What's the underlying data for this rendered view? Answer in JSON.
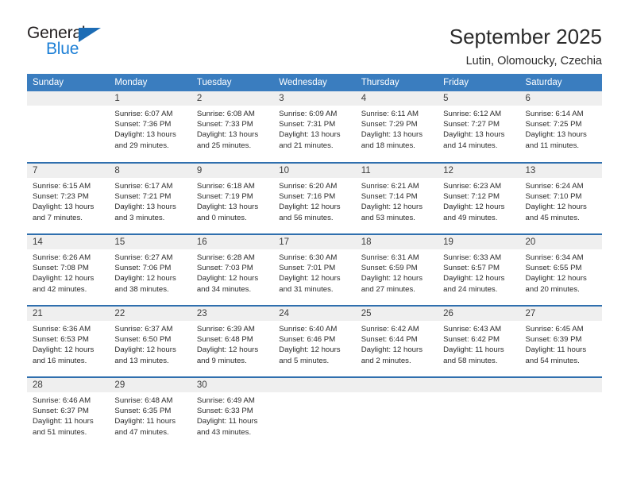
{
  "brand": {
    "name_top": "General",
    "name_bottom": "Blue",
    "accent_color": "#1c7fd6",
    "triangle_color": "#1c6cb5"
  },
  "header": {
    "title": "September 2025",
    "subtitle": "Lutin, Olomoucky, Czechia"
  },
  "calendar": {
    "header_color": "#3a7dbf",
    "daynum_background": "#efefef",
    "row_divider_color": "#2f6fae",
    "weekday_headers": [
      "Sunday",
      "Monday",
      "Tuesday",
      "Wednesday",
      "Thursday",
      "Friday",
      "Saturday"
    ],
    "labels": {
      "sunrise": "Sunrise:",
      "sunset": "Sunset:",
      "daylight": "Daylight:"
    },
    "weeks": [
      [
        {
          "day": "",
          "sunrise": "",
          "sunset": "",
          "daylight_line1": "",
          "daylight_line2": ""
        },
        {
          "day": "1",
          "sunrise": "Sunrise: 6:07 AM",
          "sunset": "Sunset: 7:36 PM",
          "daylight_line1": "Daylight: 13 hours",
          "daylight_line2": "and 29 minutes."
        },
        {
          "day": "2",
          "sunrise": "Sunrise: 6:08 AM",
          "sunset": "Sunset: 7:33 PM",
          "daylight_line1": "Daylight: 13 hours",
          "daylight_line2": "and 25 minutes."
        },
        {
          "day": "3",
          "sunrise": "Sunrise: 6:09 AM",
          "sunset": "Sunset: 7:31 PM",
          "daylight_line1": "Daylight: 13 hours",
          "daylight_line2": "and 21 minutes."
        },
        {
          "day": "4",
          "sunrise": "Sunrise: 6:11 AM",
          "sunset": "Sunset: 7:29 PM",
          "daylight_line1": "Daylight: 13 hours",
          "daylight_line2": "and 18 minutes."
        },
        {
          "day": "5",
          "sunrise": "Sunrise: 6:12 AM",
          "sunset": "Sunset: 7:27 PM",
          "daylight_line1": "Daylight: 13 hours",
          "daylight_line2": "and 14 minutes."
        },
        {
          "day": "6",
          "sunrise": "Sunrise: 6:14 AM",
          "sunset": "Sunset: 7:25 PM",
          "daylight_line1": "Daylight: 13 hours",
          "daylight_line2": "and 11 minutes."
        }
      ],
      [
        {
          "day": "7",
          "sunrise": "Sunrise: 6:15 AM",
          "sunset": "Sunset: 7:23 PM",
          "daylight_line1": "Daylight: 13 hours",
          "daylight_line2": "and 7 minutes."
        },
        {
          "day": "8",
          "sunrise": "Sunrise: 6:17 AM",
          "sunset": "Sunset: 7:21 PM",
          "daylight_line1": "Daylight: 13 hours",
          "daylight_line2": "and 3 minutes."
        },
        {
          "day": "9",
          "sunrise": "Sunrise: 6:18 AM",
          "sunset": "Sunset: 7:19 PM",
          "daylight_line1": "Daylight: 13 hours",
          "daylight_line2": "and 0 minutes."
        },
        {
          "day": "10",
          "sunrise": "Sunrise: 6:20 AM",
          "sunset": "Sunset: 7:16 PM",
          "daylight_line1": "Daylight: 12 hours",
          "daylight_line2": "and 56 minutes."
        },
        {
          "day": "11",
          "sunrise": "Sunrise: 6:21 AM",
          "sunset": "Sunset: 7:14 PM",
          "daylight_line1": "Daylight: 12 hours",
          "daylight_line2": "and 53 minutes."
        },
        {
          "day": "12",
          "sunrise": "Sunrise: 6:23 AM",
          "sunset": "Sunset: 7:12 PM",
          "daylight_line1": "Daylight: 12 hours",
          "daylight_line2": "and 49 minutes."
        },
        {
          "day": "13",
          "sunrise": "Sunrise: 6:24 AM",
          "sunset": "Sunset: 7:10 PM",
          "daylight_line1": "Daylight: 12 hours",
          "daylight_line2": "and 45 minutes."
        }
      ],
      [
        {
          "day": "14",
          "sunrise": "Sunrise: 6:26 AM",
          "sunset": "Sunset: 7:08 PM",
          "daylight_line1": "Daylight: 12 hours",
          "daylight_line2": "and 42 minutes."
        },
        {
          "day": "15",
          "sunrise": "Sunrise: 6:27 AM",
          "sunset": "Sunset: 7:06 PM",
          "daylight_line1": "Daylight: 12 hours",
          "daylight_line2": "and 38 minutes."
        },
        {
          "day": "16",
          "sunrise": "Sunrise: 6:28 AM",
          "sunset": "Sunset: 7:03 PM",
          "daylight_line1": "Daylight: 12 hours",
          "daylight_line2": "and 34 minutes."
        },
        {
          "day": "17",
          "sunrise": "Sunrise: 6:30 AM",
          "sunset": "Sunset: 7:01 PM",
          "daylight_line1": "Daylight: 12 hours",
          "daylight_line2": "and 31 minutes."
        },
        {
          "day": "18",
          "sunrise": "Sunrise: 6:31 AM",
          "sunset": "Sunset: 6:59 PM",
          "daylight_line1": "Daylight: 12 hours",
          "daylight_line2": "and 27 minutes."
        },
        {
          "day": "19",
          "sunrise": "Sunrise: 6:33 AM",
          "sunset": "Sunset: 6:57 PM",
          "daylight_line1": "Daylight: 12 hours",
          "daylight_line2": "and 24 minutes."
        },
        {
          "day": "20",
          "sunrise": "Sunrise: 6:34 AM",
          "sunset": "Sunset: 6:55 PM",
          "daylight_line1": "Daylight: 12 hours",
          "daylight_line2": "and 20 minutes."
        }
      ],
      [
        {
          "day": "21",
          "sunrise": "Sunrise: 6:36 AM",
          "sunset": "Sunset: 6:53 PM",
          "daylight_line1": "Daylight: 12 hours",
          "daylight_line2": "and 16 minutes."
        },
        {
          "day": "22",
          "sunrise": "Sunrise: 6:37 AM",
          "sunset": "Sunset: 6:50 PM",
          "daylight_line1": "Daylight: 12 hours",
          "daylight_line2": "and 13 minutes."
        },
        {
          "day": "23",
          "sunrise": "Sunrise: 6:39 AM",
          "sunset": "Sunset: 6:48 PM",
          "daylight_line1": "Daylight: 12 hours",
          "daylight_line2": "and 9 minutes."
        },
        {
          "day": "24",
          "sunrise": "Sunrise: 6:40 AM",
          "sunset": "Sunset: 6:46 PM",
          "daylight_line1": "Daylight: 12 hours",
          "daylight_line2": "and 5 minutes."
        },
        {
          "day": "25",
          "sunrise": "Sunrise: 6:42 AM",
          "sunset": "Sunset: 6:44 PM",
          "daylight_line1": "Daylight: 12 hours",
          "daylight_line2": "and 2 minutes."
        },
        {
          "day": "26",
          "sunrise": "Sunrise: 6:43 AM",
          "sunset": "Sunset: 6:42 PM",
          "daylight_line1": "Daylight: 11 hours",
          "daylight_line2": "and 58 minutes."
        },
        {
          "day": "27",
          "sunrise": "Sunrise: 6:45 AM",
          "sunset": "Sunset: 6:39 PM",
          "daylight_line1": "Daylight: 11 hours",
          "daylight_line2": "and 54 minutes."
        }
      ],
      [
        {
          "day": "28",
          "sunrise": "Sunrise: 6:46 AM",
          "sunset": "Sunset: 6:37 PM",
          "daylight_line1": "Daylight: 11 hours",
          "daylight_line2": "and 51 minutes."
        },
        {
          "day": "29",
          "sunrise": "Sunrise: 6:48 AM",
          "sunset": "Sunset: 6:35 PM",
          "daylight_line1": "Daylight: 11 hours",
          "daylight_line2": "and 47 minutes."
        },
        {
          "day": "30",
          "sunrise": "Sunrise: 6:49 AM",
          "sunset": "Sunset: 6:33 PM",
          "daylight_line1": "Daylight: 11 hours",
          "daylight_line2": "and 43 minutes."
        },
        {
          "day": "",
          "sunrise": "",
          "sunset": "",
          "daylight_line1": "",
          "daylight_line2": ""
        },
        {
          "day": "",
          "sunrise": "",
          "sunset": "",
          "daylight_line1": "",
          "daylight_line2": ""
        },
        {
          "day": "",
          "sunrise": "",
          "sunset": "",
          "daylight_line1": "",
          "daylight_line2": ""
        },
        {
          "day": "",
          "sunrise": "",
          "sunset": "",
          "daylight_line1": "",
          "daylight_line2": ""
        }
      ]
    ]
  }
}
